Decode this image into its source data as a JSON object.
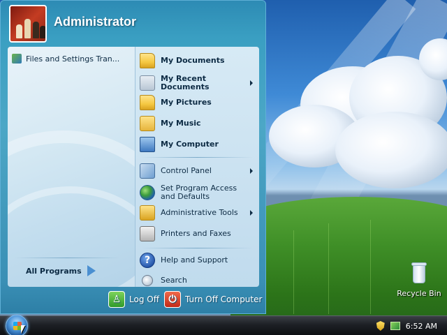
{
  "desktop": {
    "recycle_bin_label": "Recycle Bin"
  },
  "start_menu": {
    "user_name": "Administrator",
    "pinned": [
      {
        "label": "Files and Settings Tran...",
        "icon": "transfer-wizard-icon"
      }
    ],
    "all_programs_label": "All Programs",
    "right_items": [
      {
        "label": "My Documents",
        "icon": "documents-folder-icon",
        "bold": true,
        "submenu": false
      },
      {
        "label": "My Recent Documents",
        "icon": "recent-documents-icon",
        "bold": true,
        "submenu": true
      },
      {
        "label": "My Pictures",
        "icon": "pictures-folder-icon",
        "bold": true,
        "submenu": false
      },
      {
        "label": "My Music",
        "icon": "music-folder-icon",
        "bold": true,
        "submenu": false
      },
      {
        "label": "My Computer",
        "icon": "computer-icon",
        "bold": true,
        "submenu": false
      },
      {
        "label": "Control Panel",
        "icon": "control-panel-icon",
        "bold": false,
        "submenu": true
      },
      {
        "label": "Set Program Access and Defaults",
        "icon": "program-access-icon",
        "bold": false,
        "submenu": false
      },
      {
        "label": "Administrative Tools",
        "icon": "admin-tools-icon",
        "bold": false,
        "submenu": true
      },
      {
        "label": "Printers and Faxes",
        "icon": "printer-icon",
        "bold": false,
        "submenu": false
      },
      {
        "label": "Help and Support",
        "icon": "help-icon",
        "bold": false,
        "submenu": false
      },
      {
        "label": "Search",
        "icon": "search-icon",
        "bold": false,
        "submenu": false
      }
    ],
    "log_off_label": "Log Off",
    "turn_off_label": "Turn Off Computer"
  },
  "taskbar": {
    "clock": "6:52 AM"
  }
}
